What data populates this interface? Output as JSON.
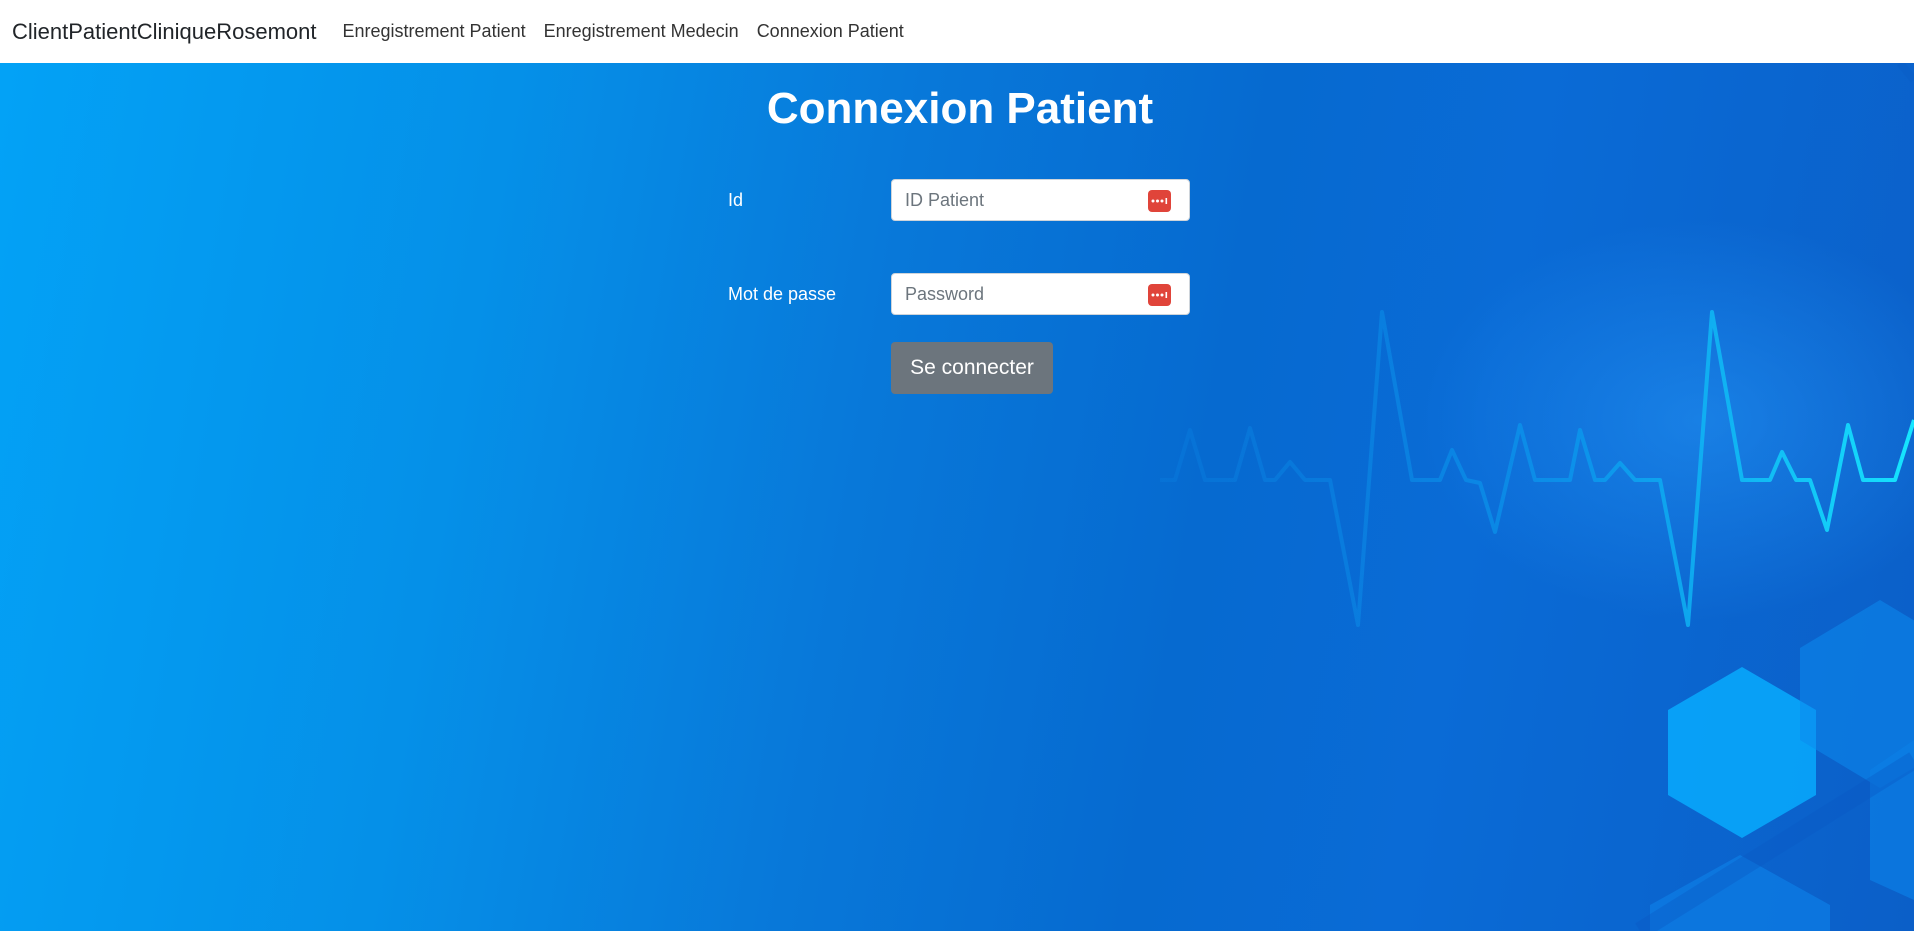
{
  "navbar": {
    "brand": "ClientPatientCliniqueRosemont",
    "links": [
      {
        "label": "Enregistrement Patient"
      },
      {
        "label": "Enregistrement Medecin"
      },
      {
        "label": "Connexion Patient"
      }
    ]
  },
  "main": {
    "title": "Connexion Patient",
    "fields": [
      {
        "label": "Id",
        "placeholder": "ID Patient",
        "value": ""
      },
      {
        "label": "Mot de passe",
        "placeholder": "Password",
        "value": ""
      }
    ],
    "submit_label": "Se connecter"
  },
  "icons": {
    "field_icon": "password-manager-icon"
  },
  "colors": {
    "background_start": "#03a2f6",
    "background_end": "#0b5fc8",
    "button": "#6c757d",
    "password_icon": "#e0443a"
  }
}
